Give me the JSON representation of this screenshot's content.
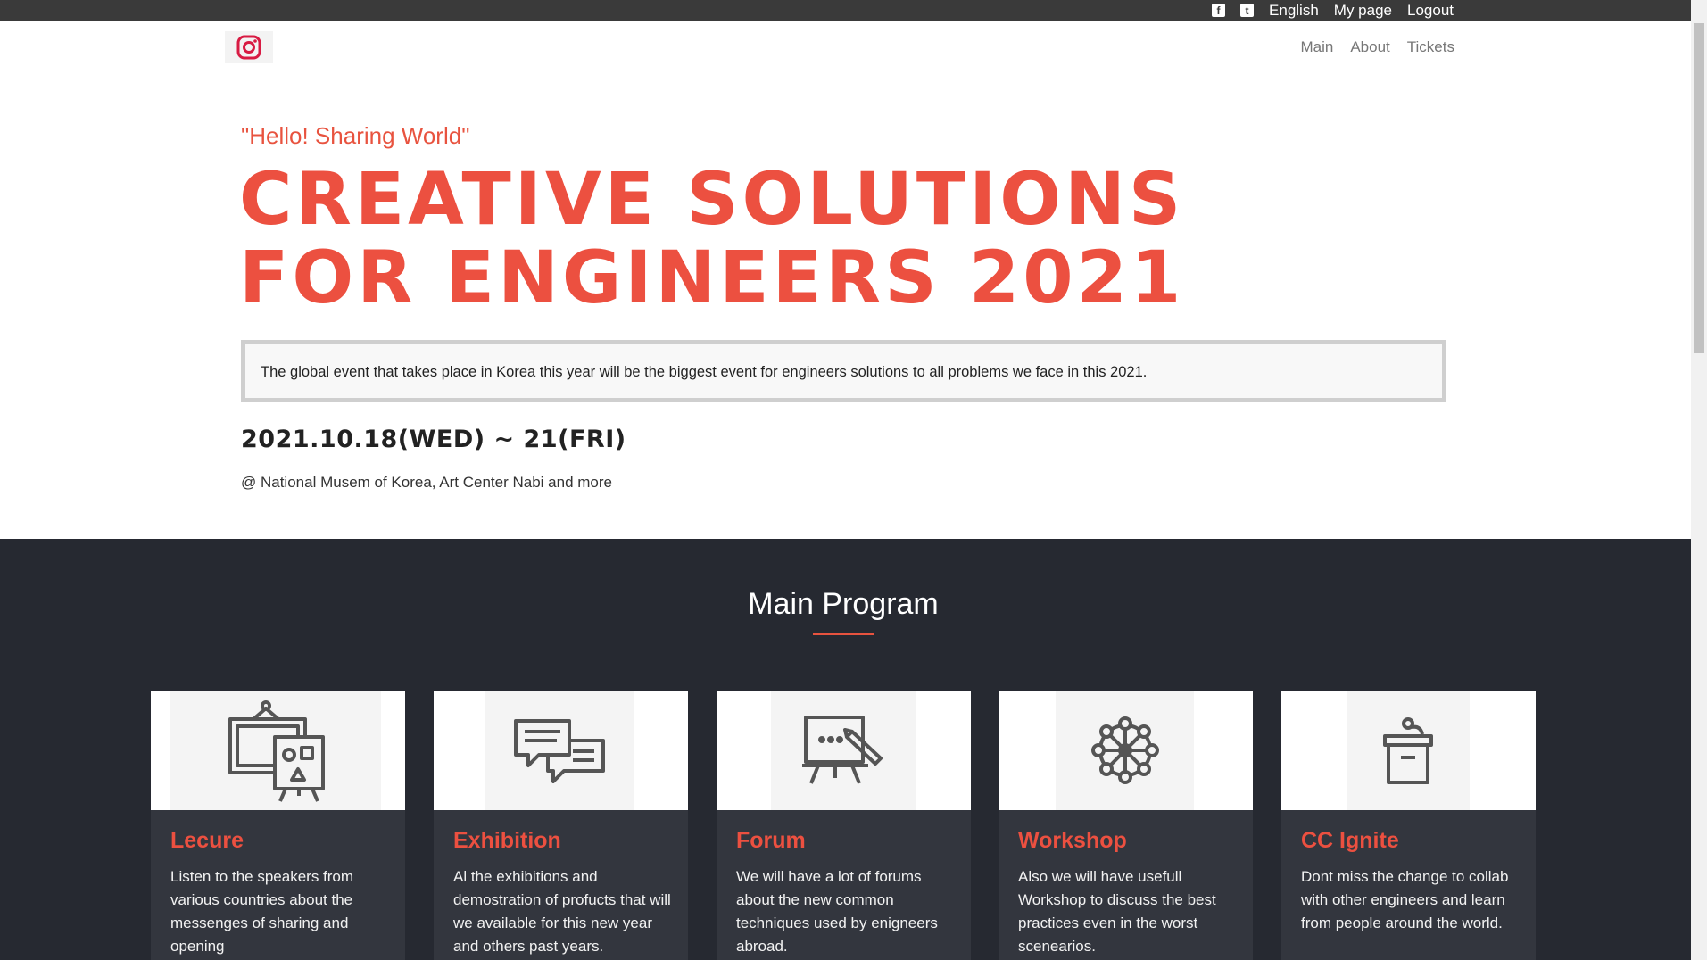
{
  "topbar": {
    "facebook_icon": "f",
    "twitter_icon": "t",
    "language": "English",
    "my_page": "My page",
    "logout": "Logout"
  },
  "nav": {
    "logo_icon": "instagram-icon",
    "items": [
      "Main",
      "About",
      "Tickets"
    ]
  },
  "hero": {
    "tagline": "\"Hello! Sharing World\"",
    "headline_line1": "CREATIVE SOLUTIONS",
    "headline_line2": "FOR ENGINEERS 2021",
    "notice": "The global event that takes place in Korea this year will be the biggest event for engineers solutions to all problems we face in this 2021.",
    "dates": "2021.10.18(WED) ~ 21(FRI)",
    "venue": "@ National Musem of Korea, Art Center Nabi and more"
  },
  "program": {
    "title": "Main Program",
    "cards": [
      {
        "icon": "presentation-board-icon",
        "title": "Lecure",
        "desc": "Listen to the speakers from various countries about the messenges of sharing and opening"
      },
      {
        "icon": "chat-bubbles-icon",
        "title": "Exhibition",
        "desc": "Al the exhibitions and demostration of profucts that will we available for this new year and others past years."
      },
      {
        "icon": "whiteboard-icon",
        "title": "Forum",
        "desc": "We will have a lot of forums about the new common techniques used by enigneers abroad."
      },
      {
        "icon": "network-circle-icon",
        "title": "Workshop",
        "desc": "Also we will have usefull Workshop to discuss the best practices even in the worst scenearios."
      },
      {
        "icon": "podium-icon",
        "title": "CC Ignite",
        "desc": "Dont miss the change to collab with other engineers and learn from people around the world."
      }
    ]
  },
  "colors": {
    "accent": "#ec5040",
    "dark_bg": "#262931",
    "card_bg": "#33363e",
    "topbar_bg": "#3a3a3a"
  }
}
